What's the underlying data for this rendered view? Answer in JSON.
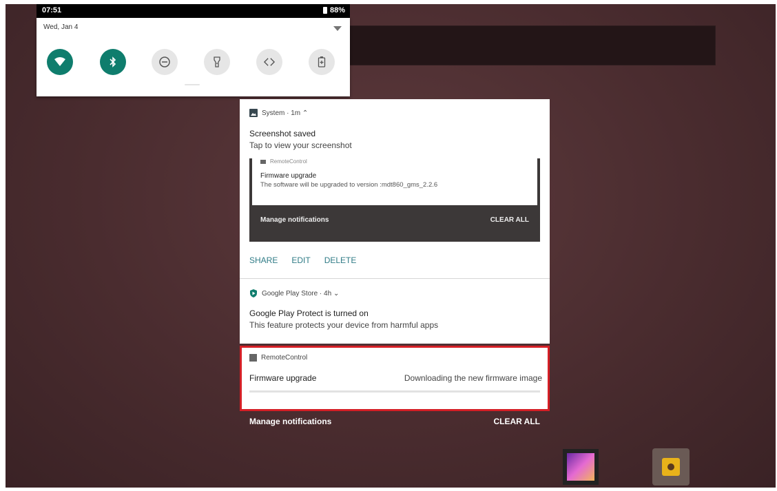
{
  "status_bar": {
    "time": "07:51",
    "battery": "88%"
  },
  "quick_settings": {
    "date": "Wed, Jan 4",
    "tiles": [
      {
        "name": "wifi",
        "state": "on"
      },
      {
        "name": "bluetooth",
        "state": "on"
      },
      {
        "name": "do-not-disturb",
        "state": "off"
      },
      {
        "name": "flashlight",
        "state": "off"
      },
      {
        "name": "auto-rotate",
        "state": "off"
      },
      {
        "name": "battery-saver",
        "state": "off"
      }
    ]
  },
  "notifications": {
    "system": {
      "header": "System · 1m ⌃",
      "title": "Screenshot saved",
      "text": "Tap to view your screenshot",
      "preview": {
        "app": "RemoteControl",
        "title": "Firmware upgrade",
        "text": "The software will be upgraded to version :mdt860_gms_2.2.6",
        "manage": "Manage notifications",
        "clear": "CLEAR ALL"
      },
      "actions": [
        "SHARE",
        "EDIT",
        "DELETE"
      ]
    },
    "play_store": {
      "header": "Google Play Store · 4h ⌄",
      "title": "Google Play Protect is turned on",
      "text": "This feature protects your device from harmful apps"
    },
    "remote_control": {
      "app": "RemoteControl",
      "title": "Firmware upgrade",
      "status": "Downloading the new firmware image",
      "progress": 0
    }
  },
  "footer": {
    "manage": "Manage notifications",
    "clear_all": "CLEAR ALL"
  },
  "colors": {
    "accent": "#0f7d6d",
    "action": "#2f7b86",
    "highlight": "#d51f26"
  }
}
